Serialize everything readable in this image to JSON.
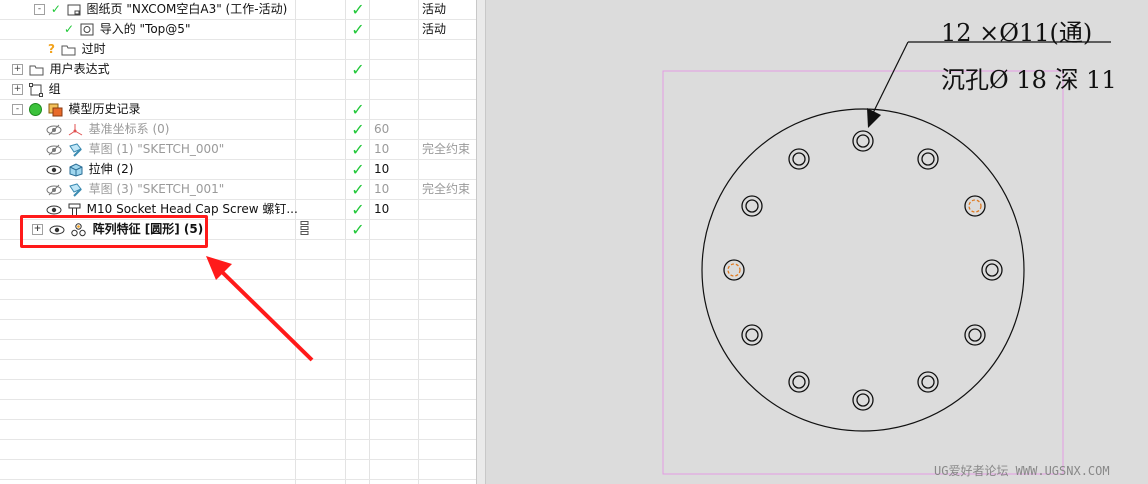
{
  "navigator": {
    "rows": [
      {
        "label": "图纸页 \"NXCOM空白A3\" (工作-活动)",
        "check": "✓",
        "num": "",
        "status": "活动"
      },
      {
        "label": "导入的 \"Top@5\"",
        "check": "✓",
        "num": "",
        "status": "活动"
      },
      {
        "label": "过时",
        "check": "",
        "num": "",
        "status": ""
      },
      {
        "label": "用户表达式",
        "check": "✓",
        "num": "",
        "status": ""
      },
      {
        "label": "组",
        "check": "",
        "num": "",
        "status": ""
      },
      {
        "label": "模型历史记录",
        "check": "✓",
        "num": "",
        "status": ""
      },
      {
        "label": "基准坐标系 (0)",
        "check": "✓",
        "num": "60",
        "status": ""
      },
      {
        "label": "草图 (1) \"SKETCH_000\"",
        "check": "✓",
        "num": "10",
        "status": "完全约束"
      },
      {
        "label": "拉伸 (2)",
        "check": "✓",
        "num": "10",
        "status": ""
      },
      {
        "label": "草图 (3) \"SKETCH_001\"",
        "check": "✓",
        "num": "10",
        "status": "完全约束"
      },
      {
        "label": "M10 Socket Head Cap Screw 螺钉...",
        "check": "✓",
        "num": "10",
        "status": ""
      },
      {
        "label": "阵列特征 [圆形] (5)",
        "check": "✓",
        "num": "",
        "status": ""
      }
    ],
    "toggles": {
      "minus": "-",
      "plus": "+"
    }
  },
  "drawing": {
    "note_line1": "12 ×Ø11(通)",
    "note_line2": "沉孔Ø 18  深 11",
    "watermark": "UG爱好者论坛 WWW.UGSNX.COM",
    "colors": {
      "background": "#dcdcdc",
      "border": "#e39be3",
      "highlight_hole": "#e07a20",
      "callout": "#ff1a1a",
      "check": "#22c83a"
    }
  }
}
